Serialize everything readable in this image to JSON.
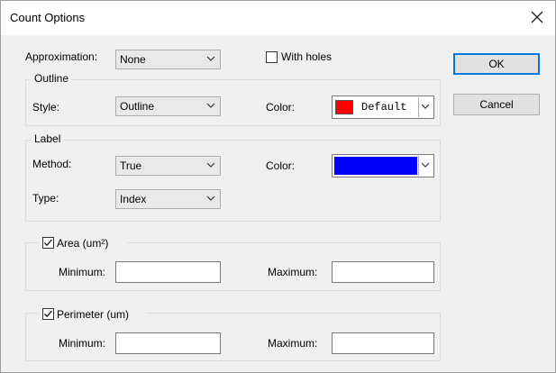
{
  "title": "Count Options",
  "approximation": {
    "label": "Approximation:",
    "value": "None"
  },
  "with_holes": {
    "label": "With holes",
    "checked": false
  },
  "outline": {
    "group_label": "Outline",
    "style_label": "Style:",
    "style_value": "Outline",
    "color_label": "Color:",
    "color_text": "Default",
    "color_swatch": "#ff0000"
  },
  "label_group": {
    "group_label": "Label",
    "method_label": "Method:",
    "method_value": "True",
    "color_label": "Color:",
    "color_fill": "#0000ff",
    "type_label": "Type:",
    "type_value": "Index"
  },
  "area": {
    "label": "Area (um²)",
    "checked": true,
    "min_label": "Minimum:",
    "max_label": "Maximum:",
    "min_value": "",
    "max_value": ""
  },
  "perimeter": {
    "label": "Perimeter (um)",
    "checked": true,
    "min_label": "Minimum:",
    "max_label": "Maximum:",
    "min_value": "",
    "max_value": ""
  },
  "buttons": {
    "ok": "OK",
    "cancel": "Cancel"
  },
  "icons": {
    "close": "close-icon",
    "chevron": "chevron-down-icon",
    "check": "checkmark-icon"
  }
}
